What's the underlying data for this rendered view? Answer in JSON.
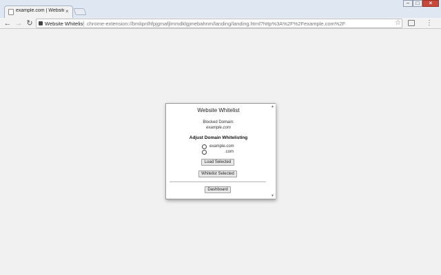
{
  "browser": {
    "tab_title": "example.com | Website W",
    "tab_close": "×",
    "minimize": "–",
    "maximize": "□",
    "close": "×"
  },
  "toolbar": {
    "back": "←",
    "forward": "→",
    "reload": "↻",
    "site_chip": "Website Whitelist",
    "url": "chrome-extension://bmlipnlhfpjgmafjlmmdklgjmebahnm/landing/landing.html?http%3A%2F%2Fexample.com%2F",
    "star": "☆",
    "menu": "⋮"
  },
  "popup": {
    "title": "Website Whitelist",
    "blocked_label": "Blocked Domain:",
    "blocked_domain": "example.com",
    "adjust_heading": "Adjust Domain Whitelisting",
    "options": [
      {
        "label": "example.com",
        "selected": false
      },
      {
        "label": ".com",
        "selected": false
      }
    ],
    "load_button": "Load Selected",
    "whitelist_button": "Whitelist Selected",
    "dashboard_button": "Dashboard",
    "scroll_up": "▲",
    "scroll_down": "▼"
  },
  "colors": {
    "page_background": "#f1f1f1",
    "titlebar": "#dfe7f2",
    "close_button": "#c9483c"
  }
}
